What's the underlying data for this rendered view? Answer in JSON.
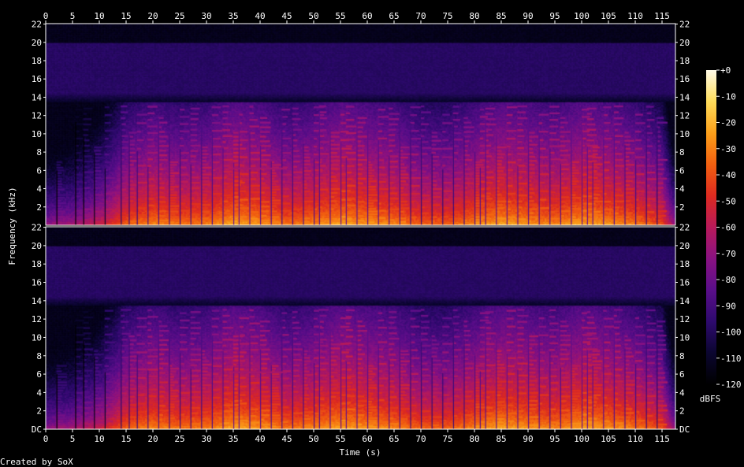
{
  "chart_data": {
    "type": "heatmap",
    "title": "",
    "xlabel": "Time (s)",
    "ylabel": "Frequency (kHz)",
    "footer": "Created by SoX",
    "xlim": [
      0,
      117.5
    ],
    "ylim_khz": [
      0,
      22.05
    ],
    "x_ticks": [
      0,
      5,
      10,
      15,
      20,
      25,
      30,
      35,
      40,
      45,
      50,
      55,
      60,
      65,
      70,
      75,
      80,
      85,
      90,
      95,
      100,
      105,
      110,
      115
    ],
    "y_ticks": [
      {
        "value": 0,
        "label": "DC"
      },
      {
        "value": 2,
        "label": "2"
      },
      {
        "value": 4,
        "label": "4"
      },
      {
        "value": 6,
        "label": "6"
      },
      {
        "value": 8,
        "label": "8"
      },
      {
        "value": 10,
        "label": "10"
      },
      {
        "value": 12,
        "label": "12"
      },
      {
        "value": 14,
        "label": "14"
      },
      {
        "value": 16,
        "label": "16"
      },
      {
        "value": 18,
        "label": "18"
      },
      {
        "value": 20,
        "label": "20"
      },
      {
        "value": 22,
        "label": "22"
      }
    ],
    "channels": [
      "channel-1",
      "channel-2"
    ],
    "colorbar": {
      "unit": "dBFS",
      "range_db": [
        -120,
        0
      ],
      "ticks": [
        {
          "value": 0,
          "label": "+0"
        },
        {
          "value": -10,
          "label": "-10"
        },
        {
          "value": -20,
          "label": "-20"
        },
        {
          "value": -30,
          "label": "-30"
        },
        {
          "value": -40,
          "label": "-40"
        },
        {
          "value": -50,
          "label": "-50"
        },
        {
          "value": -60,
          "label": "-60"
        },
        {
          "value": -70,
          "label": "-70"
        },
        {
          "value": -80,
          "label": "-80"
        },
        {
          "value": -90,
          "label": "-90"
        },
        {
          "value": -100,
          "label": "-100"
        },
        {
          "value": -110,
          "label": "-110"
        },
        {
          "value": -120,
          "label": "-120"
        }
      ],
      "colors": [
        "#000000",
        "#0b0630",
        "#2e0a6e",
        "#5a0e8a",
        "#8a1282",
        "#b81a5a",
        "#de2a20",
        "#f26010",
        "#fca01a",
        "#fedc5a",
        "#fffbe8"
      ]
    },
    "noise_floor_db": -115,
    "band_floor_db": -100,
    "band_khz": [
      13.5,
      20.05
    ],
    "band_top_fade_khz": 14.5,
    "low_energy_envelope": [
      {
        "t": 0,
        "db": -60
      },
      {
        "t": 5,
        "db": -55
      },
      {
        "t": 10,
        "db": -45
      },
      {
        "t": 15,
        "db": -25
      },
      {
        "t": 20,
        "db": -18
      },
      {
        "t": 25,
        "db": -22
      },
      {
        "t": 30,
        "db": -20
      },
      {
        "t": 35,
        "db": -12
      },
      {
        "t": 40,
        "db": -15
      },
      {
        "t": 45,
        "db": -22
      },
      {
        "t": 50,
        "db": -18
      },
      {
        "t": 55,
        "db": -12
      },
      {
        "t": 60,
        "db": -15
      },
      {
        "t": 65,
        "db": -18
      },
      {
        "t": 70,
        "db": -25
      },
      {
        "t": 75,
        "db": -25
      },
      {
        "t": 80,
        "db": -18
      },
      {
        "t": 85,
        "db": -12
      },
      {
        "t": 90,
        "db": -15
      },
      {
        "t": 95,
        "db": -18
      },
      {
        "t": 100,
        "db": -12
      },
      {
        "t": 105,
        "db": -15
      },
      {
        "t": 110,
        "db": -20
      },
      {
        "t": 115,
        "db": -30
      },
      {
        "t": 117.5,
        "db": -60
      }
    ],
    "onset_times": [
      2,
      5.5,
      7,
      9,
      11,
      14,
      15.5,
      17,
      19,
      21,
      23,
      25,
      27,
      29,
      31,
      33,
      35,
      36,
      38,
      40,
      42,
      44,
      46,
      48,
      50,
      51,
      53,
      55,
      56,
      58,
      60,
      62,
      64,
      66,
      68,
      70,
      72,
      74,
      76,
      78,
      80,
      81,
      82,
      84,
      86,
      88,
      90,
      92,
      94,
      96,
      98,
      100,
      101,
      102,
      104,
      106,
      108,
      110,
      112,
      114
    ],
    "sustained_tone": {
      "freq_khz": 6.2,
      "t_start": 35,
      "t_end": 45,
      "db": -65
    }
  }
}
